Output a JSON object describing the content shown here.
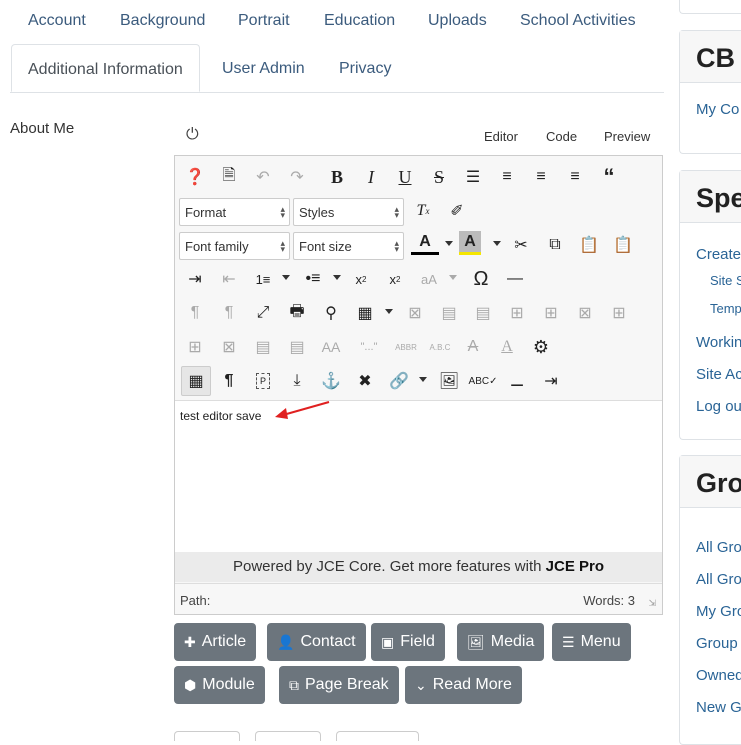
{
  "tabs": [
    {
      "label": "Account"
    },
    {
      "label": "Background"
    },
    {
      "label": "Portrait"
    },
    {
      "label": "Education"
    },
    {
      "label": "Uploads"
    },
    {
      "label": "School Activities"
    },
    {
      "label": "Additional Information"
    },
    {
      "label": "User Admin"
    },
    {
      "label": "Privacy"
    }
  ],
  "field_label": "About Me",
  "modes": {
    "editor": "Editor",
    "code": "Code",
    "preview": "Preview"
  },
  "selects": {
    "format": "Format",
    "styles": "Styles",
    "font_family": "Font family",
    "font_size": "Font size"
  },
  "editor_content": "test editor save",
  "powered": {
    "prefix": "Powered by JCE Core. Get more features with ",
    "brand": "JCE Pro"
  },
  "status": {
    "path_label": "Path:",
    "words": "Words: 3"
  },
  "buttons": {
    "article": "Article",
    "contact": "Contact",
    "field": "Field",
    "media": "Media",
    "menu": "Menu",
    "module": "Module",
    "page_break": "Page Break",
    "read_more": "Read More"
  },
  "sidebar": {
    "box1": {
      "title": "CB C",
      "items": [
        "My Co"
      ]
    },
    "box2": {
      "title": "Spe",
      "items": [
        "Create",
        "Site S",
        "Temp",
        "Workin",
        "Site Ac",
        "Log ou"
      ]
    },
    "box3": {
      "title": "Gro",
      "items": [
        "All Gro",
        "All Gro",
        "My Gro",
        "Group",
        "Owned",
        "New G"
      ]
    }
  },
  "colors": {
    "link": "#3b5b7d",
    "button": "#6c757d",
    "arrow": "#e02020",
    "highlight": "#f5e600"
  }
}
